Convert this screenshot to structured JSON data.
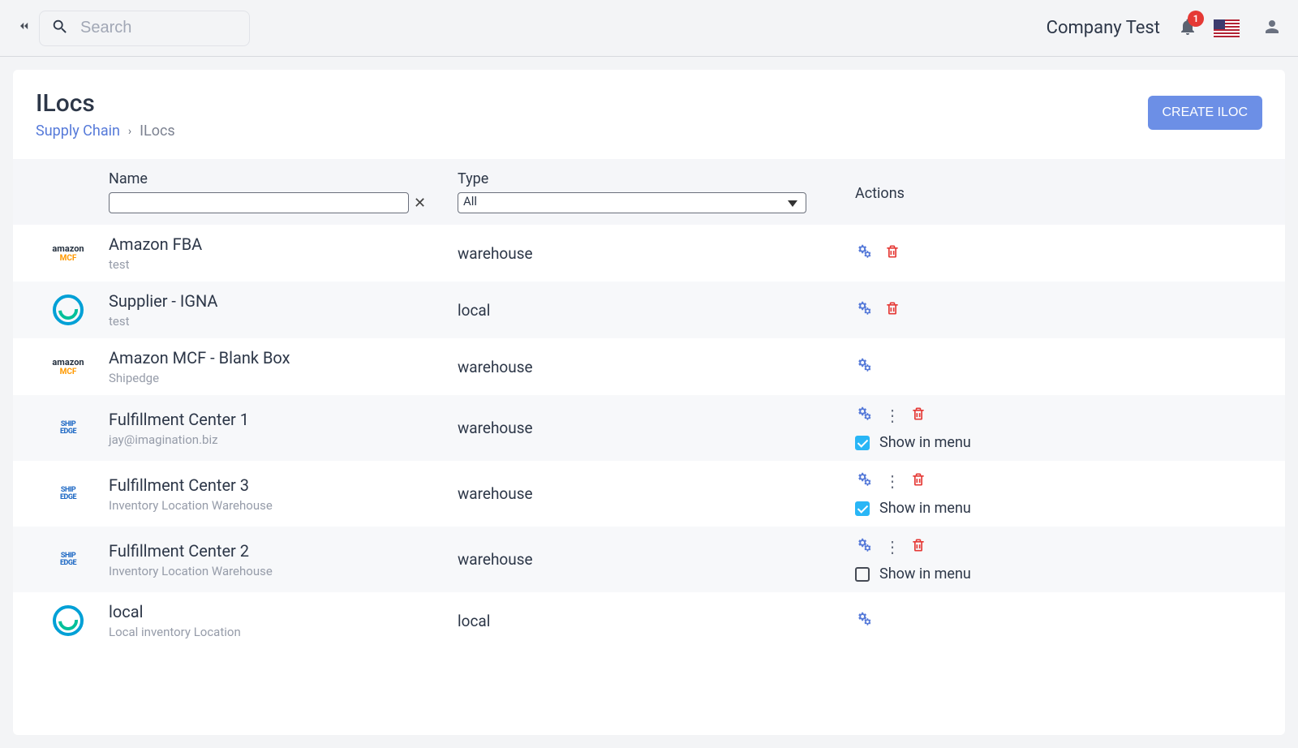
{
  "header": {
    "search_placeholder": "Search",
    "company": "Company Test",
    "notifications": "1"
  },
  "page": {
    "title": "ILocs",
    "breadcrumb_root": "Supply Chain",
    "breadcrumb_sep": "›",
    "breadcrumb_current": "ILocs",
    "create_button": "CREATE ILOC"
  },
  "columns": {
    "name": "Name",
    "type": "Type",
    "actions": "Actions",
    "type_filter_value": "All",
    "show_in_menu": "Show in menu"
  },
  "rows": [
    {
      "name": "Amazon FBA",
      "sub": "test",
      "type": "warehouse",
      "logo": "amz",
      "has_trash": true,
      "has_more": false,
      "show_menu": null
    },
    {
      "name": "Supplier - IGNA",
      "sub": "test",
      "type": "local",
      "logo": "circle",
      "has_trash": true,
      "has_more": false,
      "show_menu": null
    },
    {
      "name": "Amazon MCF - Blank Box",
      "sub": "Shipedge",
      "type": "warehouse",
      "logo": "amz",
      "has_trash": false,
      "has_more": false,
      "show_menu": null
    },
    {
      "name": "Fulfillment Center 1",
      "sub": "jay@imagination.biz",
      "type": "warehouse",
      "logo": "ship",
      "has_trash": true,
      "has_more": true,
      "show_menu": true
    },
    {
      "name": "Fulfillment Center 3",
      "sub": "Inventory Location Warehouse",
      "type": "warehouse",
      "logo": "ship",
      "has_trash": true,
      "has_more": true,
      "show_menu": true
    },
    {
      "name": "Fulfillment Center 2",
      "sub": "Inventory Location Warehouse",
      "type": "warehouse",
      "logo": "ship",
      "has_trash": true,
      "has_more": true,
      "show_menu": false
    },
    {
      "name": "local",
      "sub": "Local inventory Location",
      "type": "local",
      "logo": "circle",
      "has_trash": false,
      "has_more": false,
      "show_menu": null
    }
  ]
}
